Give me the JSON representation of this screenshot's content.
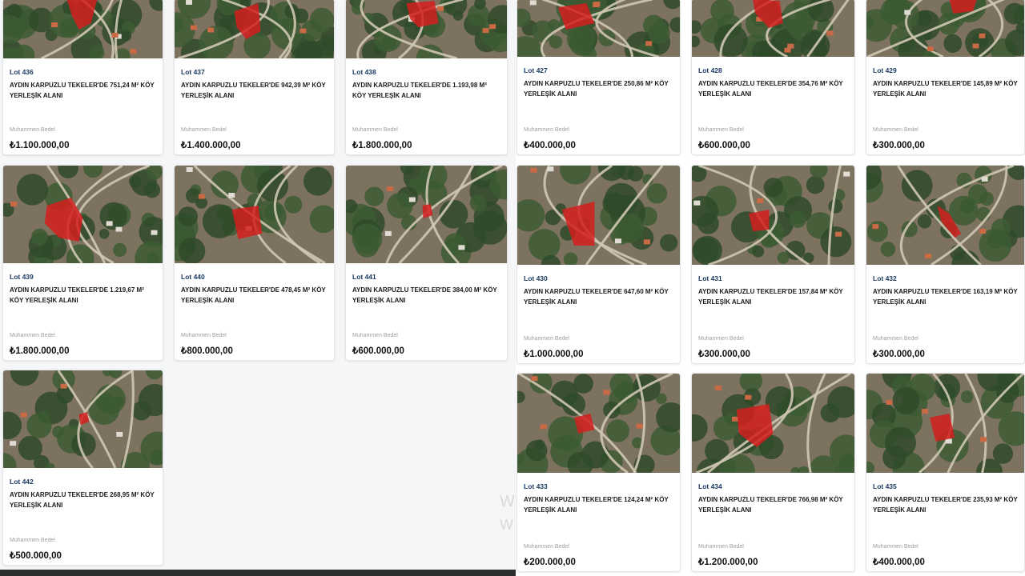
{
  "price_label": "Muhammen Bedel",
  "left_cards": [
    {
      "lot": "Lot 436",
      "title": "AYDIN KARPUZLU TEKELER'DE 751,24 M² KÖY YERLEŞİK ALANI",
      "price": "₺1.100.000,00"
    },
    {
      "lot": "Lot 437",
      "title": "AYDIN KARPUZLU TEKELER'DE 942,39 M² KÖY YERLEŞİK ALANI",
      "price": "₺1.400.000,00"
    },
    {
      "lot": "Lot 438",
      "title": "AYDIN KARPUZLU TEKELER'DE 1.193,98 M² KÖY YERLEŞİK ALANI",
      "price": "₺1.800.000,00"
    },
    {
      "lot": "Lot 439",
      "title": "AYDIN KARPUZLU TEKELER'DE 1.219,67 M² KÖY YERLEŞİK ALANI",
      "price": "₺1.800.000,00"
    },
    {
      "lot": "Lot 440",
      "title": "AYDIN KARPUZLU TEKELER'DE 478,45 M² KÖY YERLEŞİK ALANI",
      "price": "₺800.000,00"
    },
    {
      "lot": "Lot 441",
      "title": "AYDIN KARPUZLU TEKELER'DE 384,00 M² KÖY YERLEŞİK ALANI",
      "price": "₺600.000,00"
    },
    {
      "lot": "Lot 442",
      "title": "AYDIN KARPUZLU TEKELER'DE 268,95 M² KÖY YERLEŞİK ALANI",
      "price": "₺500.000,00"
    }
  ],
  "right_cards": [
    {
      "lot": "Lot 427",
      "title": "AYDIN KARPUZLU TEKELER'DE 250,86 M² KÖY YERLEŞİK ALANI",
      "price": "₺400.000,00"
    },
    {
      "lot": "Lot 428",
      "title": "AYDIN KARPUZLU TEKELER'DE 354,76 M² KÖY YERLEŞİK ALANI",
      "price": "₺600.000,00"
    },
    {
      "lot": "Lot 429",
      "title": "AYDIN KARPUZLU TEKELER'DE 145,89 M² KÖY YERLEŞİK ALANI",
      "price": "₺300.000,00"
    },
    {
      "lot": "Lot 430",
      "title": "AYDIN KARPUZLU TEKELER'DE 647,60 M² KÖY YERLEŞİK ALANI",
      "price": "₺1.000.000,00"
    },
    {
      "lot": "Lot 431",
      "title": "AYDIN KARPUZLU TEKELER'DE 157,84 M² KÖY YERLEŞİK ALANI",
      "price": "₺300.000,00"
    },
    {
      "lot": "Lot 432",
      "title": "AYDIN KARPUZLU TEKELER'DE 163,19 M² KÖY YERLEŞİK ALANI",
      "price": "₺300.000,00"
    },
    {
      "lot": "Lot 433",
      "title": "AYDIN KARPUZLU TEKELER'DE 124,24 M² KÖY YERLEŞİK ALANI",
      "price": "₺200.000,00"
    },
    {
      "lot": "Lot 434",
      "title": "AYDIN KARPUZLU TEKELER'DE 766,98 M² KÖY YERLEŞİK ALANI",
      "price": "₺1.200.000,00"
    },
    {
      "lot": "Lot 435",
      "title": "AYDIN KARPUZLU TEKELER'DE 235,93 M² KÖY YERLEŞİK ALANI",
      "price": "₺400.000,00"
    }
  ],
  "watermark": [
    "W",
    "W"
  ],
  "colors": {
    "lot_text": "#1c3b63",
    "parcel_highlight": "#d41f1f",
    "terrain": "#7a6f5c",
    "vegetation": "#2f4a2a"
  }
}
